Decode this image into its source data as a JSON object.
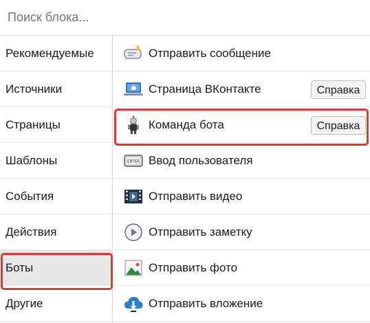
{
  "search": {
    "placeholder": "Поиск блока..."
  },
  "categories": [
    {
      "label": "Рекомендуемые"
    },
    {
      "label": "Источники"
    },
    {
      "label": "Страницы"
    },
    {
      "label": "Шаблоны"
    },
    {
      "label": "События"
    },
    {
      "label": "Действия"
    },
    {
      "label": "Боты"
    },
    {
      "label": "Другие"
    }
  ],
  "selected_category": "Боты",
  "blocks": [
    {
      "label": "Отправить сообщение",
      "icon": "message-bell-icon"
    },
    {
      "label": "Страница ВКонтакте",
      "icon": "laptop-thumbs-up-icon",
      "help": "Справка"
    },
    {
      "label": "Команда бота",
      "icon": "robot-icon",
      "help": "Справка"
    },
    {
      "label": "Ввод пользователя",
      "icon": "enter-key-icon"
    },
    {
      "label": "Отправить видео",
      "icon": "film-icon"
    },
    {
      "label": "Отправить заметку",
      "icon": "play-circle-icon"
    },
    {
      "label": "Отправить фото",
      "icon": "photo-icon"
    },
    {
      "label": "Отправить вложение",
      "icon": "cloud-download-icon"
    }
  ],
  "highlight_color": "#d93a34"
}
